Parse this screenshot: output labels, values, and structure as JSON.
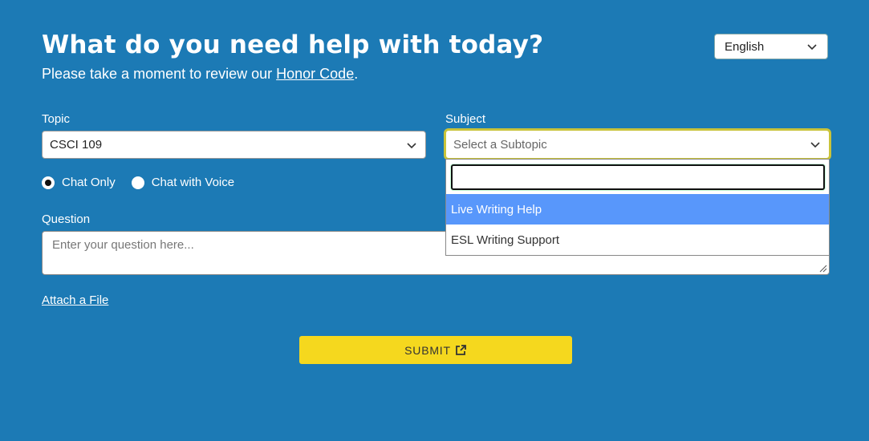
{
  "header": {
    "title": "What do you need help with today?",
    "subtitle_prefix": "Please take a moment to review our ",
    "subtitle_link": "Honor Code",
    "subtitle_suffix": "."
  },
  "language": {
    "selected": "English"
  },
  "topic": {
    "label": "Topic",
    "value": "CSCI 109"
  },
  "subject": {
    "label": "Subject",
    "placeholder": "Select a Subtopic",
    "dropdown_open": true,
    "options": [
      {
        "label": "Live Writing Help",
        "highlighted": true
      },
      {
        "label": "ESL Writing Support",
        "highlighted": false
      }
    ]
  },
  "mode": {
    "options": [
      {
        "label": "Chat Only",
        "checked": true
      },
      {
        "label": "Chat with Voice",
        "checked": false
      }
    ]
  },
  "question": {
    "label": "Question",
    "placeholder": "Enter your question here..."
  },
  "attach_label": "Attach a File",
  "submit_label": "SUBMIT",
  "colors": {
    "background": "#1c7ab5",
    "submit": "#f5d81e",
    "highlight": "#5897fb",
    "focus_border": "#c9c33a"
  },
  "icons": {
    "chevron": "chevron-down-icon",
    "external": "external-link-icon"
  }
}
